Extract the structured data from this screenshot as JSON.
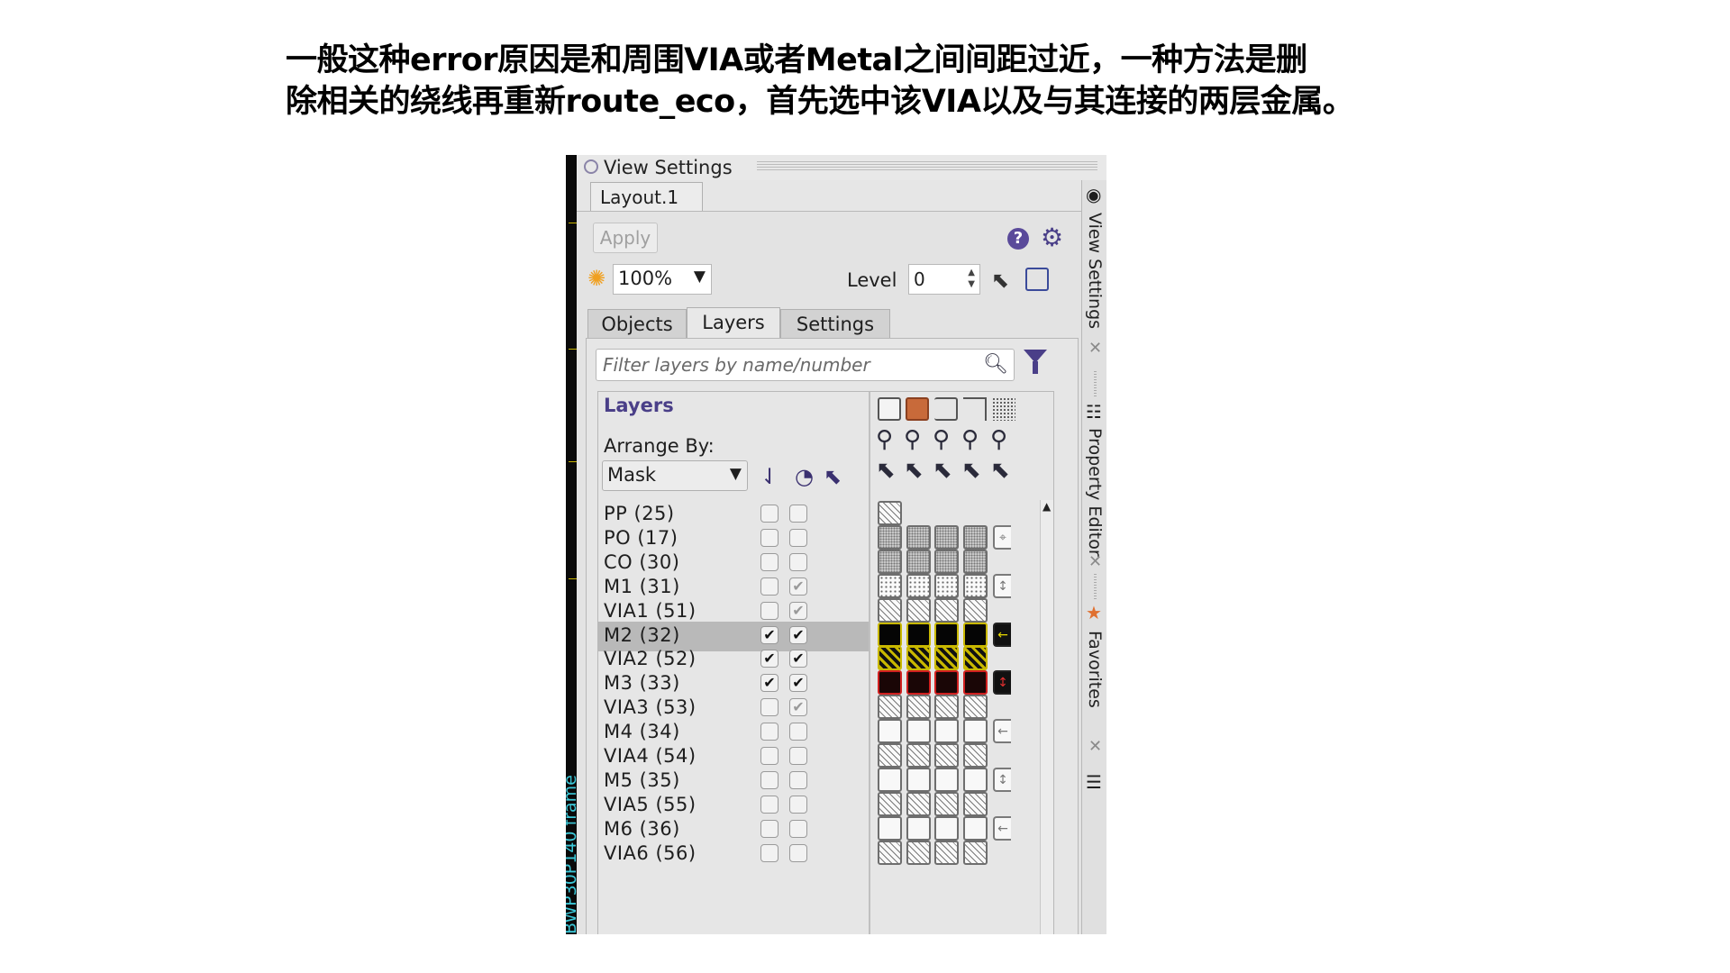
{
  "heading": {
    "line1": "一般这种error原因是和周围VIA或者Metal之间间距过近，一种方法是删",
    "line2": "除相关的绕线再重新route_eco，首先选中该VIA以及与其连接的两层金属。"
  },
  "window": {
    "title": "View Settings",
    "doc_tab": "Layout.1",
    "apply_label": "Apply",
    "zoom_value": "100%",
    "level_label": "Level",
    "level_value": "0",
    "tabs": [
      "Objects",
      "Layers",
      "Settings"
    ],
    "active_tab": "Layers",
    "filter_placeholder": "Filter layers by name/number",
    "layers_title": "Layers",
    "arrange_label": "Arrange By:",
    "arrange_value": "Mask"
  },
  "side_frame_label": "BWP30P140 frame",
  "dock_tabs": [
    "View Settings",
    "Property Editor",
    "Favorites"
  ],
  "icons": {
    "help": "help-icon",
    "settings": "gear-icon",
    "brightness": "sun-icon",
    "search": "search-icon",
    "filter": "funnel-icon",
    "sort": "sort-icon",
    "visible": "eye-icon",
    "selectable": "cursor-icon",
    "close": "close-icon",
    "star": "star-icon"
  },
  "colors": {
    "accent": "#4a3f88",
    "m2_fill": "#050505",
    "m2_border": "#c9b800",
    "m3_border": "#d02020",
    "frame_text": "#3cc8d8"
  },
  "layers": [
    {
      "name": "PP (25)",
      "vis": false,
      "sel": false,
      "sel_dim": false,
      "pattern": "hatch",
      "count": 1,
      "extra": ""
    },
    {
      "name": "PO (17)",
      "vis": false,
      "sel": false,
      "sel_dim": false,
      "pattern": "dense",
      "count": 4,
      "extra": "⌖"
    },
    {
      "name": "CO (30)",
      "vis": false,
      "sel": false,
      "sel_dim": false,
      "pattern": "dense",
      "count": 4,
      "extra": ""
    },
    {
      "name": "M1 (31)",
      "vis": false,
      "sel": true,
      "sel_dim": true,
      "pattern": "dots",
      "count": 4,
      "extra": "↕"
    },
    {
      "name": "VIA1 (51)",
      "vis": false,
      "sel": true,
      "sel_dim": true,
      "pattern": "hatch",
      "count": 4,
      "extra": ""
    },
    {
      "name": "M2 (32)",
      "vis": true,
      "sel": true,
      "sel_dim": false,
      "pattern": "black",
      "count": 4,
      "extra": "←",
      "extra_style": "dark",
      "selected": true
    },
    {
      "name": "VIA2 (52)",
      "vis": true,
      "sel": true,
      "sel_dim": false,
      "pattern": "yhatch",
      "count": 4,
      "extra": ""
    },
    {
      "name": "M3 (33)",
      "vis": true,
      "sel": true,
      "sel_dim": false,
      "pattern": "red",
      "count": 4,
      "extra": "↕",
      "extra_style": "darkred"
    },
    {
      "name": "VIA3 (53)",
      "vis": false,
      "sel": true,
      "sel_dim": true,
      "pattern": "hatch",
      "count": 4,
      "extra": ""
    },
    {
      "name": "M4 (34)",
      "vis": false,
      "sel": false,
      "sel_dim": false,
      "pattern": "blank",
      "count": 4,
      "extra": "←"
    },
    {
      "name": "VIA4 (54)",
      "vis": false,
      "sel": false,
      "sel_dim": false,
      "pattern": "hatch",
      "count": 4,
      "extra": ""
    },
    {
      "name": "M5 (35)",
      "vis": false,
      "sel": false,
      "sel_dim": false,
      "pattern": "blank",
      "count": 4,
      "extra": "↕"
    },
    {
      "name": "VIA5 (55)",
      "vis": false,
      "sel": false,
      "sel_dim": false,
      "pattern": "hatch",
      "count": 4,
      "extra": ""
    },
    {
      "name": "M6 (36)",
      "vis": false,
      "sel": false,
      "sel_dim": false,
      "pattern": "blank",
      "count": 4,
      "extra": "←"
    },
    {
      "name": "VIA6 (56)",
      "vis": false,
      "sel": false,
      "sel_dim": false,
      "pattern": "hatch",
      "count": 4,
      "extra": ""
    }
  ]
}
